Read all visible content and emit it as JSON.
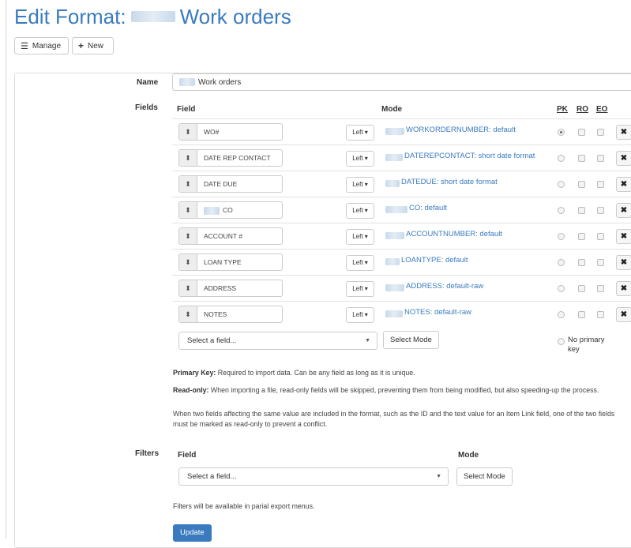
{
  "page": {
    "title_prefix": "Edit Format:",
    "title_suffix": "Work orders"
  },
  "toolbar": {
    "manage_label": "Manage",
    "new_label": "New"
  },
  "name": {
    "label": "Name",
    "value": "Work orders"
  },
  "fields": {
    "label": "Fields",
    "headers": {
      "field": "Field",
      "mode": "Mode",
      "pk": "PK",
      "ro": "RO",
      "eo": "EO"
    },
    "rows": [
      {
        "field": "WO#",
        "align": "Left",
        "mode": "WORKORDERNUMBER: default",
        "pk": true
      },
      {
        "field": "DATE REP CONTACT",
        "align": "Left",
        "mode": "DATEREPCONTACT: short date format",
        "pk": false
      },
      {
        "field": "DATE DUE",
        "align": "Left",
        "mode": "DATEDUE: short date format",
        "pk": false
      },
      {
        "field": "CO",
        "align": "Left",
        "mode": "CO: default",
        "pk": false
      },
      {
        "field": "ACCOUNT #",
        "align": "Left",
        "mode": "ACCOUNTNUMBER: default",
        "pk": false
      },
      {
        "field": "LOAN TYPE",
        "align": "Left",
        "mode": "LOANTYPE: default",
        "pk": false
      },
      {
        "field": "ADDRESS",
        "align": "Left",
        "mode": "ADDRESS: default-raw",
        "pk": false
      },
      {
        "field": "NOTES",
        "align": "Left",
        "mode": "NOTES: default-raw",
        "pk": false
      }
    ],
    "select_placeholder": "Select a field...",
    "select_mode_label": "Select Mode",
    "no_primary_key": "No primary key"
  },
  "help": {
    "pk_title": "Primary Key:",
    "pk_text": "Required to import data. Can be any field as long as it is unique.",
    "ro_title": "Read-only:",
    "ro_text": "When importing a file, read-only fields will be skipped, preventing them from being modified, but also speeding-up the process.",
    "conflict_text": "When two fields affecting the same value are included in the format, such as the ID and the text value for an Item Link field, one of the two fields must be marked as read-only to prevent a conflict."
  },
  "filters": {
    "label": "Filters",
    "field_header": "Field",
    "mode_header": "Mode",
    "select_placeholder": "Select a field...",
    "select_mode_label": "Select Mode",
    "note": "Filters will be available in parial export menus."
  },
  "update_label": "Update",
  "colors": {
    "accent": "#3a7bbf",
    "border": "#cccccc"
  }
}
